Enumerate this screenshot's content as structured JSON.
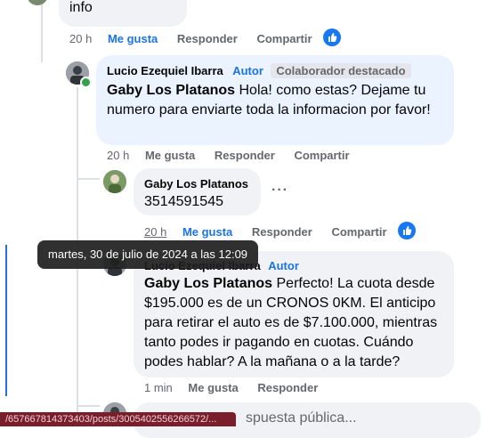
{
  "top_comment": {
    "text_tail": "info",
    "time": "20 h",
    "like": "Me gusta",
    "reply": "Responder",
    "share": "Compartir"
  },
  "reply1": {
    "author": "Lucio Ezequiel Ibarra",
    "author_tag": "Autor",
    "badge": "Colaborador destacado",
    "mention": "Gaby Los Platanos",
    "text": " Hola! como estas? Dejame tu numero para enviarte toda la informacion por favor!",
    "time": "20 h",
    "like": "Me gusta",
    "reply": "Responder",
    "share": "Compartir"
  },
  "reply2": {
    "author": "Gaby Los Platanos",
    "text": "3514591545",
    "more": "···",
    "time": "20 h",
    "like": "Me gusta",
    "reply": "Responder",
    "share": "Compartir"
  },
  "tooltip": {
    "text": "martes, 30 de julio de 2024 a las 12:09"
  },
  "reply3": {
    "author": "Lucio Ezequiel Ibarra",
    "author_tag": "Autor",
    "mention": "Gaby Los Platanos",
    "text": " Perfecto! La cuota desde $195.000 es de un CRONOS 0KM. El anticipo para retirar el auto es de $7.100.000, mientras tanto podes ir pagando en cuotas. Cuándo podes hablar? A la mañana o a la tarde?",
    "time": "1 min",
    "like": "Me gusta",
    "reply": "Responder"
  },
  "composer": {
    "placeholder": "spuesta pública..."
  },
  "status_url": "/657667814373403/posts/3005402556266572/...",
  "colors": {
    "link_blue": "#1b74e4",
    "bubble": "#f0f2f5",
    "highlight_bubble": "#eaf3ff",
    "online": "#31a24c"
  }
}
